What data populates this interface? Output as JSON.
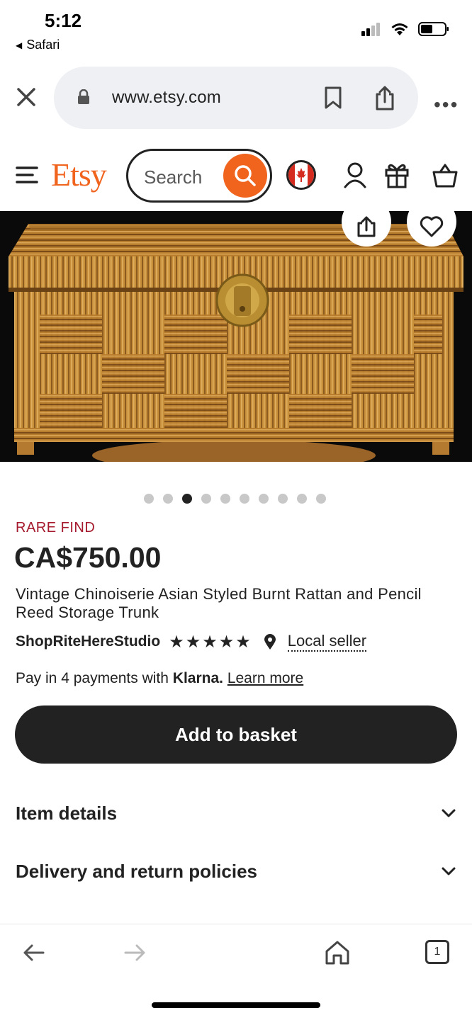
{
  "status_bar": {
    "time": "5:12",
    "back_app": "Safari"
  },
  "browser": {
    "url": "www.etsy.com",
    "tab_count": "1"
  },
  "header": {
    "logo": "Etsy",
    "search_placeholder": "Search"
  },
  "product": {
    "image_count": 10,
    "active_image_index": 2,
    "badge": "RARE FIND",
    "price": "CA$750.00",
    "title": "Vintage Chinoiserie Asian Styled Burnt Rattan and Pencil Reed Storage Trunk",
    "shop_name": "ShopRiteHereStudio",
    "rating_stars": "★★★★★",
    "rating_value": 5,
    "local_seller": "Local seller",
    "payment_prefix": "Pay in 4 payments with",
    "payment_brand": "Klarna.",
    "learn_more": "Learn more",
    "add_to_basket": "Add to basket"
  },
  "accordions": [
    {
      "label": "Item details"
    },
    {
      "label": "Delivery and return policies"
    }
  ],
  "colors": {
    "etsy_orange": "#f1641e",
    "rare_find": "#a61a2e",
    "button_dark": "#222222"
  }
}
